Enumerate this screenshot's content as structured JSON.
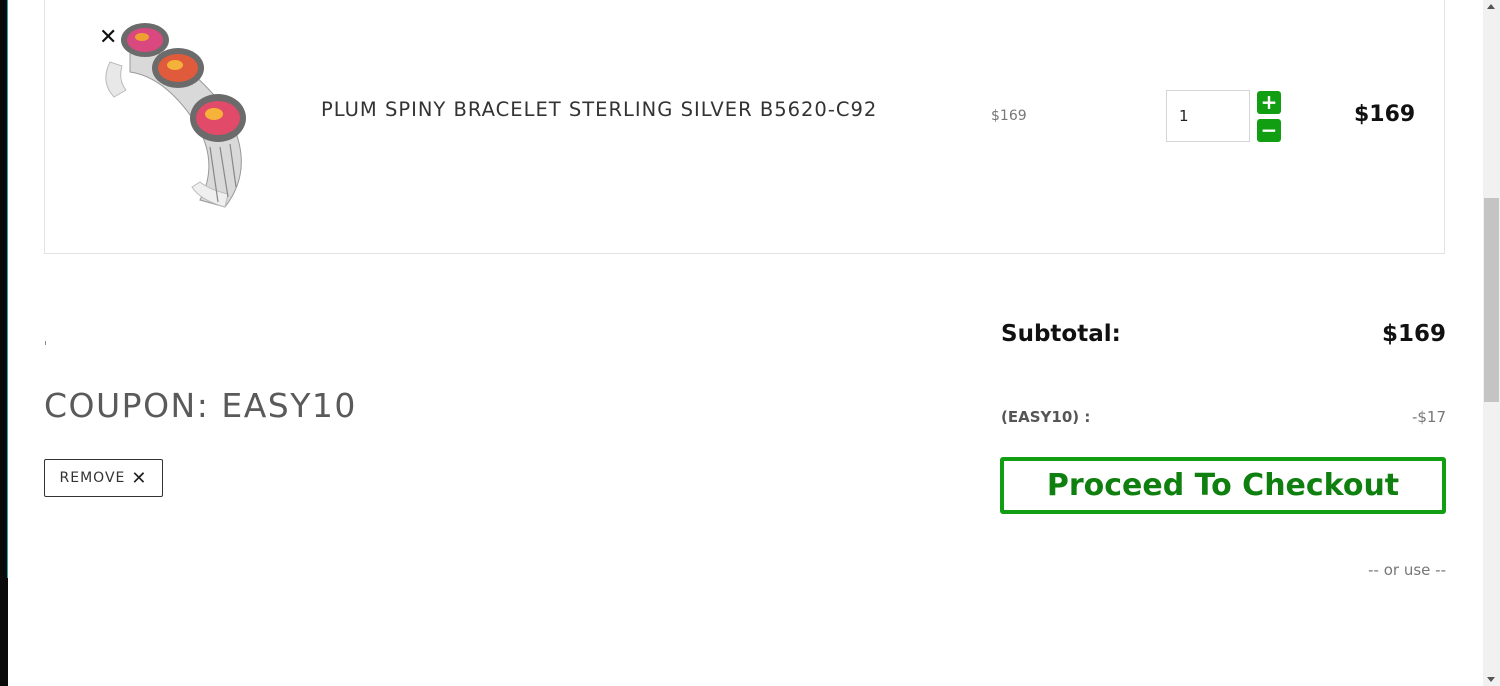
{
  "cart": {
    "item": {
      "remove_icon": "close-icon",
      "image_alt": "bracelet-image",
      "name": "PLUM SPINY BRACELET STERLING SILVER B5620-C92",
      "unit_price": "$169",
      "quantity": "1",
      "qty_plus": "+",
      "qty_minus": "−",
      "line_total": "$169"
    }
  },
  "coupon": {
    "title": "COUPON: EASY10",
    "remove_label": "REMOVE",
    "remove_icon": "✕"
  },
  "summary": {
    "subtotal_label": "Subtotal:",
    "subtotal_value": "$169",
    "discount_label": "(EASY10) :",
    "discount_value": "-$17",
    "checkout_label": "Proceed To Checkout",
    "or_use": "-- or use --"
  },
  "colors": {
    "accent_green": "#129e12",
    "checkout_text": "#0f800f"
  }
}
